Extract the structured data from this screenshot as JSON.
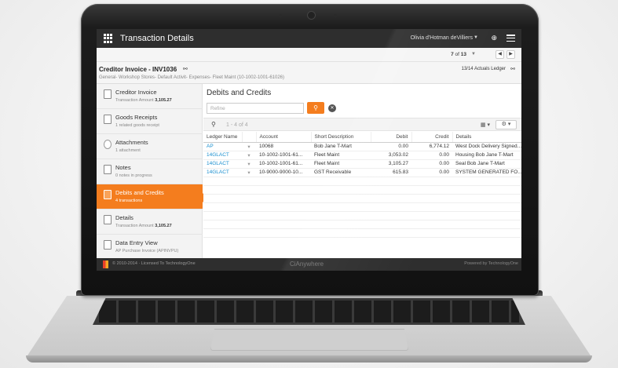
{
  "app": {
    "title": "Transaction Details",
    "user": "Olivia d'Hotman deVilliers",
    "pager": {
      "current": "7",
      "of_label": "of",
      "total": "13"
    }
  },
  "doc": {
    "title": "Creditor Invoice - INV1036",
    "subtitle": "General- Workshop Stores- Default Activit- Expenses- Fleet Maint (10-1002-1001-61026)",
    "ledger_info": "13/14 Actuals Ledger"
  },
  "sidebar": {
    "items": [
      {
        "title": "Creditor Invoice",
        "sub": "Transaction Amount",
        "sub_value": "3,105.27"
      },
      {
        "title": "Goods Receipts",
        "sub": "1 related goods receipt",
        "sub_value": ""
      },
      {
        "title": "Attachments",
        "sub": "1 attachment",
        "sub_value": ""
      },
      {
        "title": "Notes",
        "sub": "0 notes in progress",
        "sub_value": ""
      },
      {
        "title": "Debits and Credits",
        "sub": "4 transactions",
        "sub_value": ""
      },
      {
        "title": "Details",
        "sub": "Transaction Amount",
        "sub_value": "3,105.27"
      },
      {
        "title": "Data Entry View",
        "sub": "AP Purchase Invoice (APINVPU)",
        "sub_value": ""
      }
    ]
  },
  "main": {
    "title": "Debits and Credits",
    "refine_placeholder": "Refine",
    "count": "1 - 4 of 4",
    "columns": [
      "Ledger Name",
      "Account",
      "Short Description",
      "Debit",
      "Credit",
      "Details"
    ],
    "rows": [
      {
        "ledger": "AP",
        "account": "10068",
        "desc": "Bob Jane T-Mart",
        "debit": "0.00",
        "credit": "6,774.12",
        "details": "West Dock Delivery Signed..."
      },
      {
        "ledger": "14GLACT",
        "account": "10-1002-1001-61...",
        "desc": "Fleet Maint",
        "debit": "3,053.02",
        "credit": "0.00",
        "details": "Housing Bob Jane T-Mart"
      },
      {
        "ledger": "14GLACT",
        "account": "10-1002-1001-61...",
        "desc": "Fleet Maint",
        "debit": "3,105.27",
        "credit": "0.00",
        "details": "Seal Bob Jane T-Mart"
      },
      {
        "ledger": "14GLACT",
        "account": "10-9000-9000-10...",
        "desc": "GST Receivable",
        "debit": "615.83",
        "credit": "0.00",
        "details": "SYSTEM GENERATED FO..."
      }
    ]
  },
  "footer": {
    "copyright": "© 2010-2014 · Licensed To TechnologyOne",
    "brand": "CiAnywhere",
    "powered": "Powered by TechnologyOne"
  },
  "colors": {
    "accent": "#f47d1e",
    "link": "#1a8fcf",
    "topbar": "#2e2e2e"
  }
}
